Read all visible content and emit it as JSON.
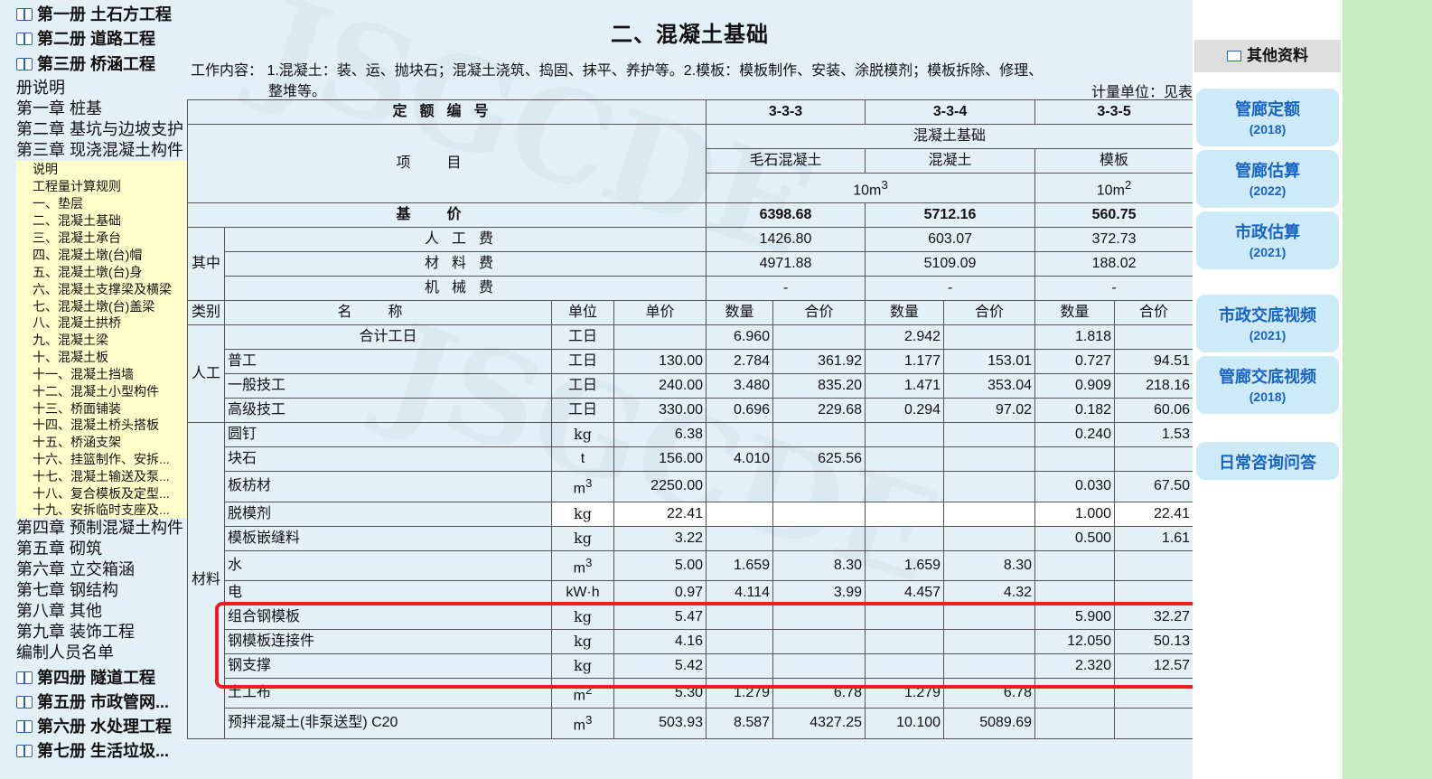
{
  "sidebar": {
    "books_top": [
      "第一册 土石方工程",
      "第二册 道路工程",
      "第三册 桥涵工程"
    ],
    "chapters_top": [
      "册说明",
      "第一章 桩基",
      "第二章 基坑与边坡支护",
      "第三章 现浇混凝土构件"
    ],
    "sub_items": [
      "说明",
      "工程量计算规则",
      "一、垫层",
      "二、混凝土基础",
      "三、混凝土承台",
      "四、混凝土墩(台)帽",
      "五、混凝土墩(台)身",
      "六、混凝土支撑梁及横梁",
      "七、混凝土墩(台)盖梁",
      "八、混凝土拱桥",
      "九、混凝土梁",
      "十、混凝土板",
      "十一、混凝土挡墙",
      "十二、混凝土小型构件",
      "十三、桥面铺装",
      "十四、混凝土桥头搭板",
      "十五、桥涵支架",
      "十六、挂篮制作、安拆...",
      "十七、混凝土输送及泵...",
      "十八、复合模板及定型...",
      "十九、安拆临时支座及..."
    ],
    "chapters_bottom": [
      "第四章 预制混凝土构件",
      "第五章 砌筑",
      "第六章 立交箱涵",
      "第七章 钢结构",
      "第八章 其他",
      "第九章 装饰工程",
      "编制人员名单"
    ],
    "books_bottom": [
      "第四册 隧道工程",
      "第五册 市政管网...",
      "第六册 水处理工程",
      "第七册 生活垃圾..."
    ]
  },
  "main": {
    "title": "二、混凝土基础",
    "work_line1": "工作内容：  1.混凝土：装、运、抛块石；混凝土浇筑、捣固、抹平、养护等。2.模板：模板制作、安装、涂脱模剂；模板拆除、修理、",
    "work_line2": "整堆等。",
    "unit": "计量单位：见表"
  },
  "table": {
    "quota_label": "定额编号",
    "codes": [
      "3-3-3",
      "3-3-4",
      "3-3-5"
    ],
    "item_label": "项目",
    "group_name": "混凝土基础",
    "sub_names": [
      "毛石混凝土",
      "混凝土",
      "模板"
    ],
    "unit_a": "10m",
    "unit_a_sup": "3",
    "unit_b": "10m",
    "unit_b_sup": "2",
    "base_label": "基价",
    "base_prices": [
      "6398.68",
      "5712.16",
      "560.75"
    ],
    "qizhong": "其中",
    "labor_fee_label": "人工费",
    "labor_fees": [
      "1426.80",
      "603.07",
      "372.73"
    ],
    "material_fee_label": "材料费",
    "material_fees": [
      "4971.88",
      "5109.09",
      "188.02"
    ],
    "machine_fee_label": "机械费",
    "machine_fees": [
      "-",
      "-",
      "-"
    ],
    "col_headers": {
      "category": "类别",
      "name": "名称",
      "unit": "单位",
      "price": "单价",
      "qty": "数量",
      "sum": "合价"
    },
    "labor_category": "人工",
    "material_category": "材料",
    "labor_rows": [
      {
        "name": "合计工日",
        "unit": "工日",
        "price": "",
        "q1": "6.960",
        "s1": "",
        "q2": "2.942",
        "s2": "",
        "q3": "1.818",
        "s3": ""
      },
      {
        "name": "普工",
        "unit": "工日",
        "price": "130.00",
        "q1": "2.784",
        "s1": "361.92",
        "q2": "1.177",
        "s2": "153.01",
        "q3": "0.727",
        "s3": "94.51"
      },
      {
        "name": "一般技工",
        "unit": "工日",
        "price": "240.00",
        "q1": "3.480",
        "s1": "835.20",
        "q2": "1.471",
        "s2": "353.04",
        "q3": "0.909",
        "s3": "218.16"
      },
      {
        "name": "高级技工",
        "unit": "工日",
        "price": "330.00",
        "q1": "0.696",
        "s1": "229.68",
        "q2": "0.294",
        "s2": "97.02",
        "q3": "0.182",
        "s3": "60.06"
      }
    ],
    "material_rows": [
      {
        "name": "圆钉",
        "unit": "kg",
        "price": "6.38",
        "q1": "",
        "s1": "",
        "q2": "",
        "s2": "",
        "q3": "0.240",
        "s3": "1.53"
      },
      {
        "name": "块石",
        "unit": "t",
        "price": "156.00",
        "q1": "4.010",
        "s1": "625.56",
        "q2": "",
        "s2": "",
        "q3": "",
        "s3": ""
      },
      {
        "name": "板枋材",
        "unit": "m",
        "unit_sup": "3",
        "price": "2250.00",
        "q1": "",
        "s1": "",
        "q2": "",
        "s2": "",
        "q3": "0.030",
        "s3": "67.50"
      },
      {
        "name": "脱模剂",
        "unit": "kg",
        "price": "22.41",
        "q1": "",
        "s1": "",
        "q2": "",
        "s2": "",
        "q3": "1.000",
        "s3": "22.41"
      },
      {
        "name": "模板嵌缝料",
        "unit": "kg",
        "price": "3.22",
        "q1": "",
        "s1": "",
        "q2": "",
        "s2": "",
        "q3": "0.500",
        "s3": "1.61"
      },
      {
        "name": "水",
        "unit": "m",
        "unit_sup": "3",
        "price": "5.00",
        "q1": "1.659",
        "s1": "8.30",
        "q2": "1.659",
        "s2": "8.30",
        "q3": "",
        "s3": ""
      },
      {
        "name": "电",
        "unit": "kW·h",
        "price": "0.97",
        "q1": "4.114",
        "s1": "3.99",
        "q2": "4.457",
        "s2": "4.32",
        "q3": "",
        "s3": ""
      },
      {
        "name": "组合钢模板",
        "unit": "kg",
        "price": "5.47",
        "q1": "",
        "s1": "",
        "q2": "",
        "s2": "",
        "q3": "5.900",
        "s3": "32.27"
      },
      {
        "name": "钢模板连接件",
        "unit": "kg",
        "price": "4.16",
        "q1": "",
        "s1": "",
        "q2": "",
        "s2": "",
        "q3": "12.050",
        "s3": "50.13"
      },
      {
        "name": "钢支撑",
        "unit": "kg",
        "price": "5.42",
        "q1": "",
        "s1": "",
        "q2": "",
        "s2": "",
        "q3": "2.320",
        "s3": "12.57"
      },
      {
        "name": "土工布",
        "unit": "m",
        "unit_sup": "2",
        "price": "5.30",
        "q1": "1.279",
        "s1": "6.78",
        "q2": "1.279",
        "s2": "6.78",
        "q3": "",
        "s3": ""
      },
      {
        "name": "预拌混凝土(非泵送型) C20",
        "unit": "m",
        "unit_sup": "3",
        "price": "503.93",
        "q1": "8.587",
        "s1": "4327.25",
        "q2": "10.100",
        "s2": "5089.69",
        "q3": "",
        "s3": ""
      }
    ]
  },
  "right": {
    "header": "其他资料",
    "links": [
      {
        "title": "管廊定额",
        "year": "(2018)"
      },
      {
        "title": "管廊估算",
        "year": "(2022)"
      },
      {
        "title": "市政估算",
        "year": "(2021)"
      },
      {
        "title": "市政交底视频",
        "year": "(2021)"
      },
      {
        "title": "管廊交底视频",
        "year": "(2018)"
      },
      {
        "title": "日常咨询问答",
        "year": ""
      }
    ]
  },
  "watermark": "JSGCDE",
  "colors": {
    "background": "#e3f1f6",
    "sub_panel": "#ffffcc",
    "link_text": "#1663c7",
    "link_bg": "#cfeaf7",
    "highlight": "#ee1c1c",
    "green_bar": "#c7ecc4"
  }
}
